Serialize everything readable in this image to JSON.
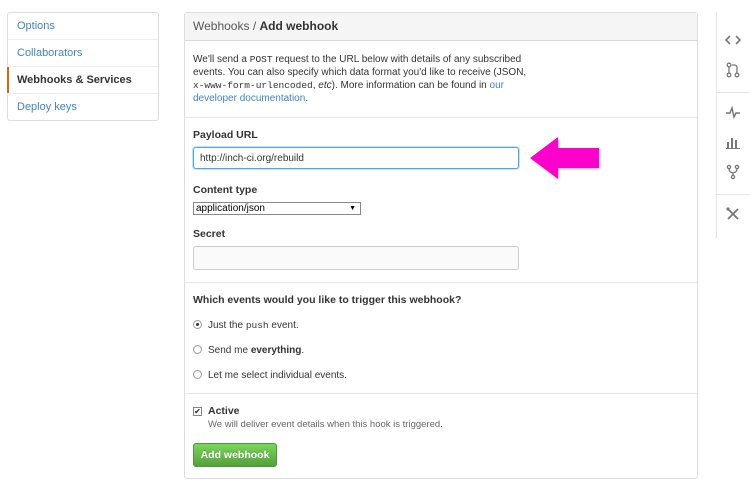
{
  "menu": {
    "items": [
      {
        "label": "Options"
      },
      {
        "label": "Collaborators"
      },
      {
        "label": "Webhooks & Services"
      },
      {
        "label": "Deploy keys"
      }
    ]
  },
  "header": {
    "crumb": "Webhooks /",
    "title": "Add webhook"
  },
  "intro": {
    "part1": "We'll send a ",
    "code1": "POST",
    "part2": " request to the URL below with details of any subscribed events. You can also specify which data format you'd like to receive (JSON, ",
    "code2": "x-www-form-urlencoded",
    "part3": ", ",
    "etc": "etc",
    "part4": "). More information can be found in ",
    "link": "our developer documentation",
    "part5": "."
  },
  "form": {
    "payload_label": "Payload URL",
    "payload_value": "http://inch-ci.org/rebuild",
    "content_type_label": "Content type",
    "content_type_value": "application/json",
    "secret_label": "Secret",
    "secret_value": ""
  },
  "events": {
    "question": "Which events would you like to trigger this webhook?",
    "opt1_pre": "Just the ",
    "opt1_code": "push",
    "opt1_post": " event.",
    "opt2_pre": "Send me ",
    "opt2_bold": "everything",
    "opt2_post": ".",
    "opt3": "Let me select individual events.",
    "selected": 0
  },
  "active": {
    "label": "Active",
    "note": "We will deliver event details when this hook is triggered.",
    "checked": true,
    "check_glyph": "✔"
  },
  "submit_label": "Add webhook",
  "rail": {
    "icons": [
      "code-icon",
      "pull-request-icon",
      "pulse-icon",
      "graph-icon",
      "network-icon",
      "settings-icon"
    ]
  },
  "colors": {
    "link": "#4183c4",
    "accent_selected": "#d26911",
    "button_green": "#6cc644",
    "annotation_arrow": "#ff00cc"
  }
}
